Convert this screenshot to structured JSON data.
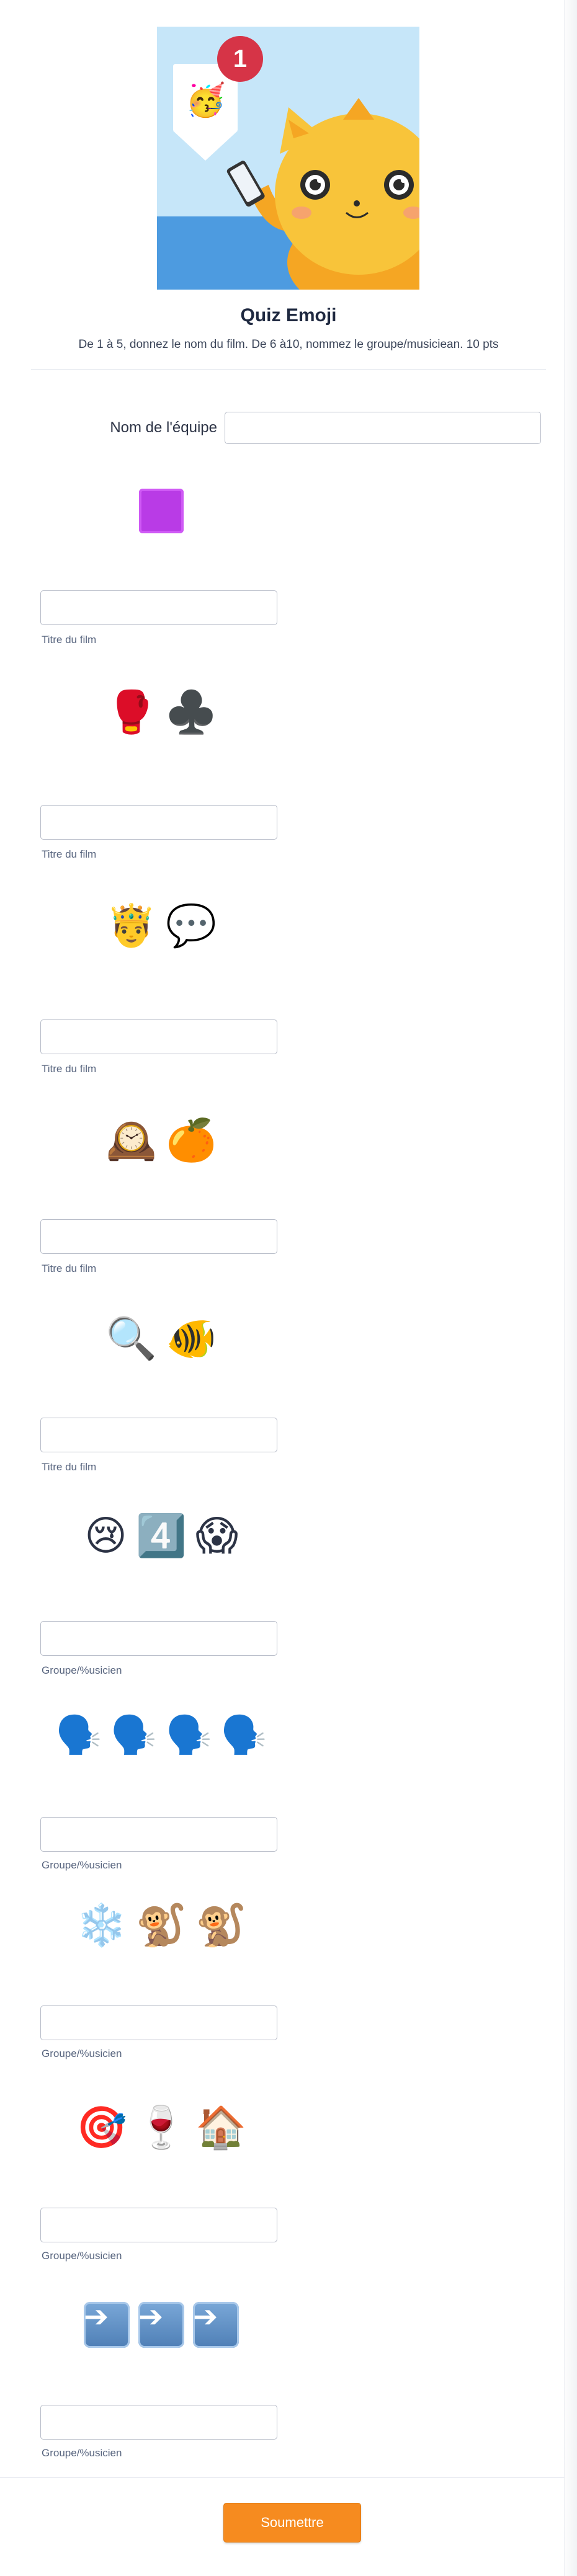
{
  "header": {
    "badge_count": "1",
    "party_emoji": "🥳",
    "title": "Quiz Emoji",
    "subtitle": "De 1 à 5, donnez le nom du film. De 6 à10, nommez le groupe/musiciean. 10 pts"
  },
  "team": {
    "label": "Nom de l'équipe",
    "value": ""
  },
  "questions": [
    {
      "emojis": [
        "🟪"
      ],
      "label": "Titre du film",
      "value": ""
    },
    {
      "emojis": [
        "🥊",
        "♣️"
      ],
      "label": "Titre du film",
      "value": ""
    },
    {
      "emojis": [
        "🤴",
        "💬"
      ],
      "label": "Titre du film",
      "value": ""
    },
    {
      "emojis": [
        "🕰️",
        "🍊"
      ],
      "label": "Titre du film",
      "value": ""
    },
    {
      "emojis": [
        "🔍",
        "🐠"
      ],
      "label": "Titre du film",
      "value": ""
    },
    {
      "emojis": [
        "😢",
        "4️⃣",
        "😱"
      ],
      "label": "Groupe/%usicien",
      "value": ""
    },
    {
      "emojis": [
        "🗣️",
        "🗣️",
        "🗣️",
        "🗣️"
      ],
      "label": "Groupe/%usicien",
      "value": ""
    },
    {
      "emojis": [
        "❄️",
        "🐒",
        "🐒"
      ],
      "label": "Groupe/%usicien",
      "value": ""
    },
    {
      "emojis": [
        "🎯",
        "🍷",
        "🏠"
      ],
      "label": "Groupe/%usicien",
      "value": ""
    },
    {
      "emojis": [
        "➡️",
        "➡️",
        "➡️"
      ],
      "label": "Groupe/%usicien",
      "value": ""
    }
  ],
  "submit_label": "Soumettre",
  "colors": {
    "submit": "#f68b1f",
    "title": "#1f2940",
    "badge": "#d63447"
  }
}
